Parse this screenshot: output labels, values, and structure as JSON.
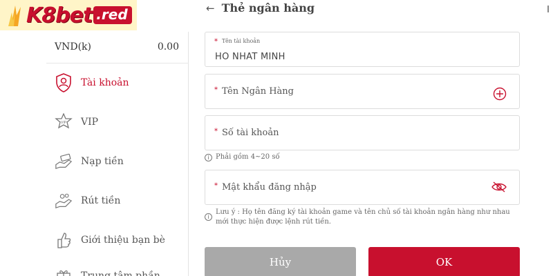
{
  "logo": {
    "brand": "K8bet",
    "tld": ".red"
  },
  "sidebar": {
    "balance": {
      "currency": "VND(k)",
      "amount": "0.00"
    },
    "items": [
      {
        "label": "Tài khoản",
        "icon": "shield-user-icon",
        "active": true
      },
      {
        "label": "VIP",
        "icon": "vip-star-icon"
      },
      {
        "label": "Nạp tiền",
        "icon": "deposit-hand-icon"
      },
      {
        "label": "Rút tiền",
        "icon": "withdraw-hand-icon"
      },
      {
        "label": "Giới thiệu bạn bè",
        "icon": "thumbs-up-icon"
      },
      {
        "label": "Trung tâm phần",
        "icon": "gift-icon"
      }
    ]
  },
  "header": {
    "title": "Thẻ ngân hàng"
  },
  "form": {
    "account_name": {
      "label": "Tên tài khoản",
      "value": "HO NHAT MINH"
    },
    "bank_name": {
      "placeholder": "Tên Ngân Hàng"
    },
    "account_number": {
      "placeholder": "Số tài khoản",
      "hint": "Phải gồm 4~20 số"
    },
    "password": {
      "placeholder": "Mật khẩu đăng nhập"
    },
    "note": "Lưu ý : Họ tên đăng ký tài khoản game và tên chủ số tài khoản ngân hàng như nhau mới thực hiện được lệnh rút tiền.",
    "cancel_label": "Hủy",
    "ok_label": "OK"
  },
  "colors": {
    "accent": "#c8102e",
    "cancel": "#a9a9a9",
    "logo_bg": "#fff5c8"
  }
}
